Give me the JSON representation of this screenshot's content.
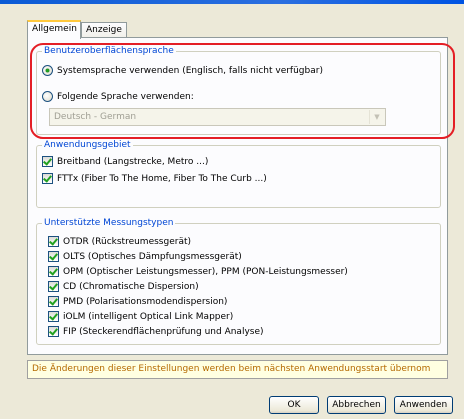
{
  "tabs": [
    {
      "label": "Allgemein",
      "active": true
    },
    {
      "label": "Anzeige",
      "active": false
    }
  ],
  "ui_language": {
    "legend": "Benutzeroberflächensprache",
    "option_system": "Systemsprache verwenden (Englisch, falls nicht verfügbar)",
    "option_system_selected": true,
    "option_following": "Folgende Sprache verwenden:",
    "option_following_selected": false,
    "language_select_value": "Deutsch - German",
    "language_select_enabled": false
  },
  "application_area": {
    "legend": "Anwendungsgebiet",
    "items": [
      {
        "label": "Breitband (Langstrecke, Metro ...)",
        "checked": true
      },
      {
        "label": "FTTx (Fiber To The Home, Fiber To The Curb ...)",
        "checked": true
      }
    ]
  },
  "measurement_types": {
    "legend": "Unterstützte Messungstypen",
    "items": [
      {
        "label": "OTDR (Rückstreumessgerät)",
        "checked": true
      },
      {
        "label": "OLTS (Optisches Dämpfungsmessgerät)",
        "checked": true
      },
      {
        "label": "OPM (Optischer Leistungsmesser), PPM (PON-Leistungsmesser)",
        "checked": true
      },
      {
        "label": "CD (Chromatische Dispersion)",
        "checked": true
      },
      {
        "label": "PMD (Polarisationsmodendispersion)",
        "checked": true
      },
      {
        "label": "iOLM (intelligent Optical Link Mapper)",
        "checked": true
      },
      {
        "label": "FIP (Steckerendflächenprüfung und Analyse)",
        "checked": true
      }
    ]
  },
  "notice": "Die Änderungen dieser Einstellungen werden beim nächsten Anwendungsstart übernom",
  "buttons": {
    "ok": "OK",
    "cancel": "Abbrechen",
    "apply": "Anwenden"
  },
  "colors": {
    "group_label": "#0046d5",
    "highlight": "#e41e25",
    "notice_text": "#b56a00",
    "check_mark": "#21a121"
  }
}
